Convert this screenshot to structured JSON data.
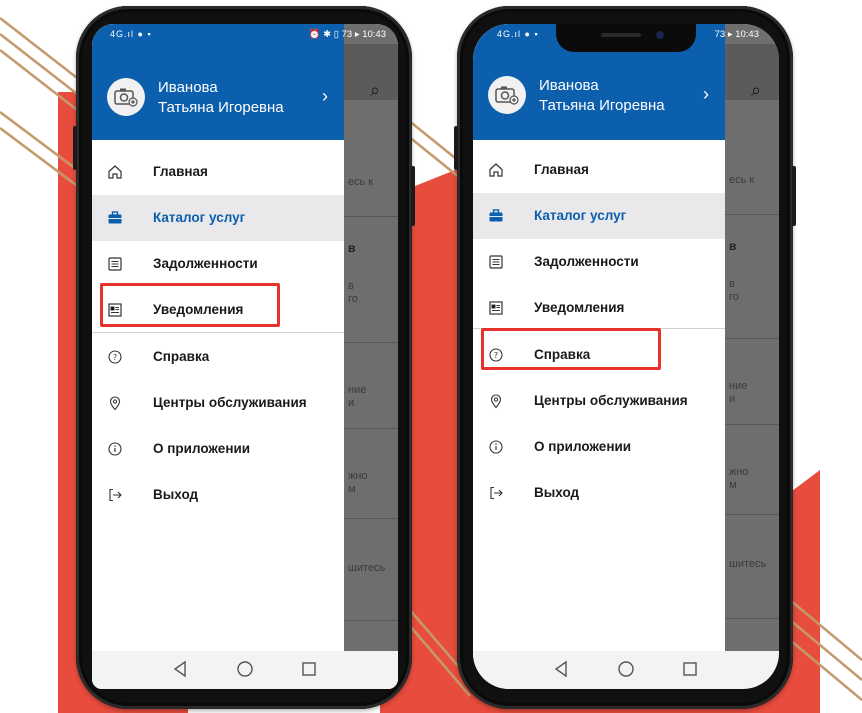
{
  "phones": [
    {
      "status_left": "4G.ıl ● ▪",
      "status_right": "⏰ ✱ ▯ 73 ▸ 10:43",
      "user_first": "Иванова",
      "user_last": "Татьяна Игоревна",
      "behind_texts": [
        "есь к",
        "в",
        "в\nго",
        "ние\nи",
        "жно\nм",
        "шитесь"
      ]
    },
    {
      "status_left": "4G.ıl ● ▪",
      "status_right": "73 ▸ 10:43",
      "user_first": "Иванова",
      "user_last": "Татьяна Игоревна",
      "behind_texts": [
        "есь к",
        "в",
        "в\nго",
        "ние\nи",
        "жно\nм",
        "шитесь"
      ]
    }
  ],
  "menu": [
    {
      "label": "Главная",
      "icon": "home-icon"
    },
    {
      "label": "Каталог услуг",
      "icon": "briefcase-icon",
      "active": true
    },
    {
      "label": "Задолженности",
      "icon": "list-icon"
    },
    {
      "label": "Уведомления",
      "icon": "notification-icon"
    },
    {
      "label": "Справка",
      "icon": "help-icon"
    },
    {
      "label": "Центры обслуживания",
      "icon": "location-icon"
    },
    {
      "label": "О приложении",
      "icon": "info-icon"
    },
    {
      "label": "Выход",
      "icon": "logout-icon"
    }
  ],
  "highlights": {
    "left_phone": "Уведомления",
    "right_phone": "Справка"
  },
  "colors": {
    "header_blue": "#0c5fad",
    "highlight_red": "#e5322d",
    "background_red": "#e84c3d",
    "stripe_gold": "#c49a6c"
  }
}
